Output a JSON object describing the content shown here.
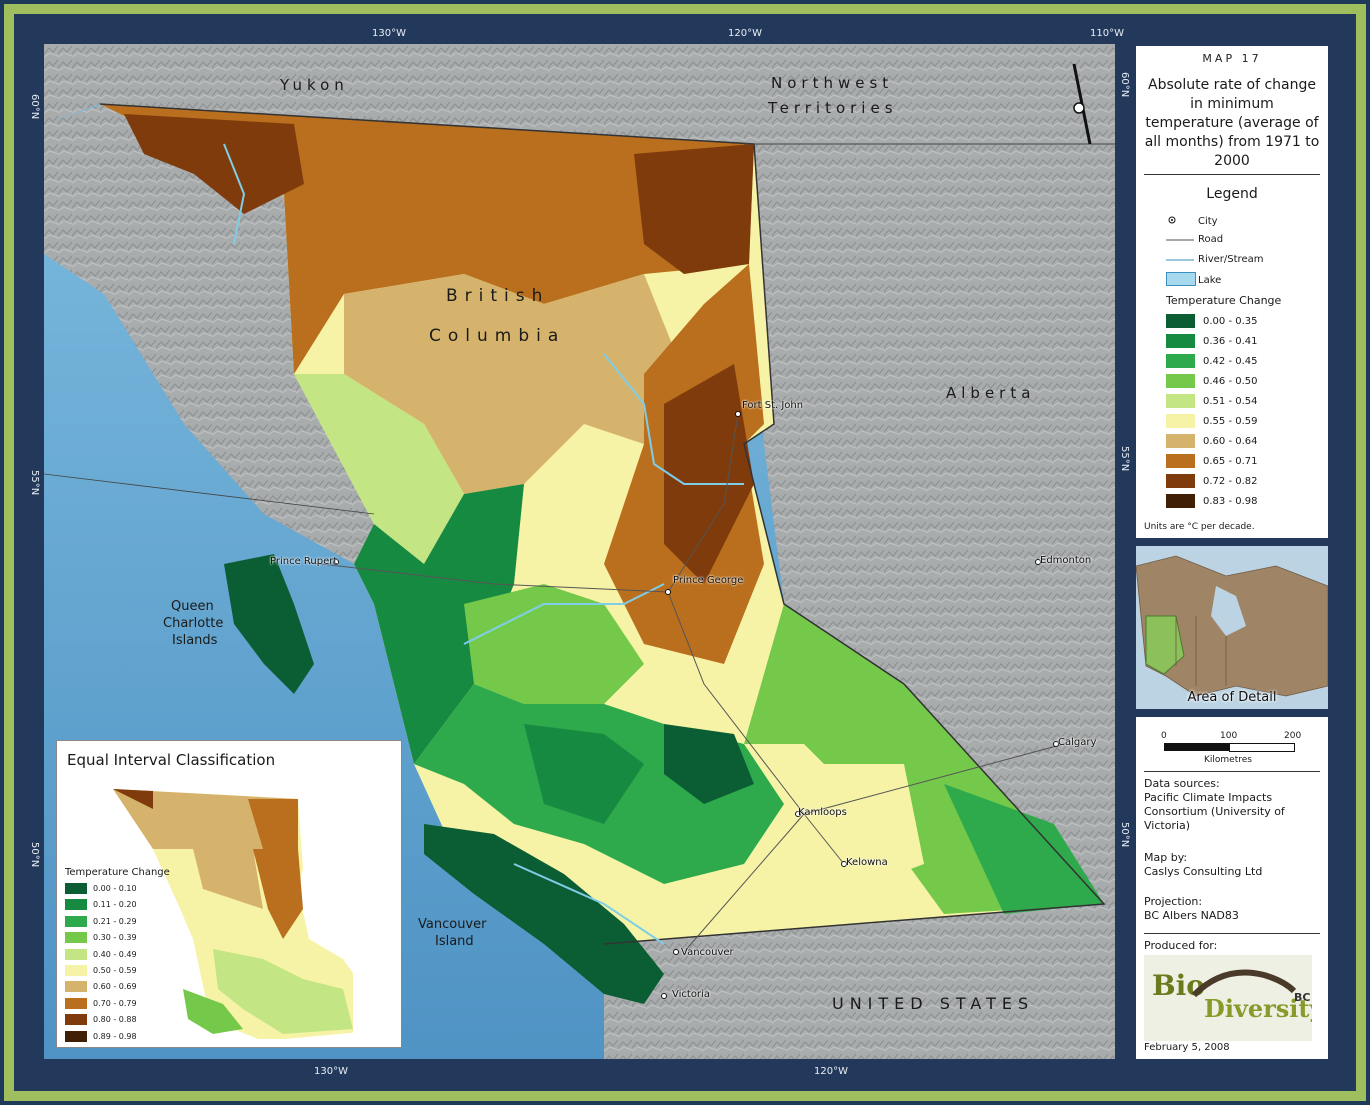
{
  "map": {
    "graticule_top": [
      "130°W",
      "120°W",
      "110°W"
    ],
    "graticule_bottom": [
      "130°W",
      "120°W"
    ],
    "graticule_left": [
      "60°N",
      "55°N",
      "50°N"
    ],
    "graticule_right": [
      "60°N",
      "55°N",
      "50°N"
    ],
    "regions": {
      "yukon": "Yukon",
      "nwt_line1": "Northwest",
      "nwt_line2": "Territories",
      "bc_line1": "British",
      "bc_line2": "Columbia",
      "alberta": "Alberta",
      "qci_line1": "Queen",
      "qci_line2": "Charlotte",
      "qci_line3": "Islands",
      "vi_line1": "Vancouver",
      "vi_line2": "Island",
      "usa": "UNITED STATES"
    },
    "cities": [
      "Fort St. John",
      "Prince Rupert",
      "Prince George",
      "Edmonton",
      "Calgary",
      "Kamloops",
      "Kelowna",
      "Vancouver",
      "Victoria"
    ]
  },
  "title_panel": {
    "map_number": "MAP 17",
    "title": "Absolute rate of change in minimum temperature (average of all months) from 1971 to 2000",
    "legend_heading": "Legend",
    "symbols": [
      "City",
      "Road",
      "River/Stream",
      "Lake"
    ],
    "temperature_change_title": "Temperature Change",
    "classes": [
      {
        "label": "0.00 - 0.35",
        "color": "#0b5e34"
      },
      {
        "label": "0.36 - 0.41",
        "color": "#178a42"
      },
      {
        "label": "0.42 - 0.45",
        "color": "#2eaa4c"
      },
      {
        "label": "0.46 - 0.50",
        "color": "#74c84a"
      },
      {
        "label": "0.51 - 0.54",
        "color": "#c4e584"
      },
      {
        "label": "0.55 - 0.59",
        "color": "#f6f3a6"
      },
      {
        "label": "0.60 - 0.64",
        "color": "#d6b36c"
      },
      {
        "label": "0.65 - 0.71",
        "color": "#b96f1e"
      },
      {
        "label": "0.72 - 0.82",
        "color": "#7f3b0c"
      },
      {
        "label": "0.83 - 0.98",
        "color": "#3f2007"
      }
    ],
    "units_note": "Units are °C per decade."
  },
  "inset_map": {
    "label": "Area of Detail"
  },
  "info_panel": {
    "scale_ticks": [
      "0",
      "100",
      "200"
    ],
    "scale_unit": "Kilometres",
    "data_sources_label": "Data sources:",
    "data_sources": "Pacific Climate Impacts Consortium (University of Victoria)",
    "map_by_label": "Map by:",
    "map_by": "Caslys Consulting Ltd",
    "projection_label": "Projection:",
    "projection": "BC Albers NAD83",
    "produced_for_label": "Produced for:",
    "logo_text": "BioDiversity BC",
    "date": "February 5, 2008"
  },
  "equal_interval": {
    "title": "Equal Interval Classification",
    "temperature_change_title": "Temperature Change",
    "classes": [
      {
        "label": "0.00 - 0.10",
        "color": "#0b5e34"
      },
      {
        "label": "0.11 - 0.20",
        "color": "#178a42"
      },
      {
        "label": "0.21 - 0.29",
        "color": "#2eaa4c"
      },
      {
        "label": "0.30 - 0.39",
        "color": "#74c84a"
      },
      {
        "label": "0.40 - 0.49",
        "color": "#c4e584"
      },
      {
        "label": "0.50 - 0.59",
        "color": "#f6f3a6"
      },
      {
        "label": "0.60 - 0.69",
        "color": "#d6b36c"
      },
      {
        "label": "0.70 - 0.79",
        "color": "#b96f1e"
      },
      {
        "label": "0.80 - 0.88",
        "color": "#7f3b0c"
      },
      {
        "label": "0.89 - 0.98",
        "color": "#3f2007"
      }
    ]
  }
}
